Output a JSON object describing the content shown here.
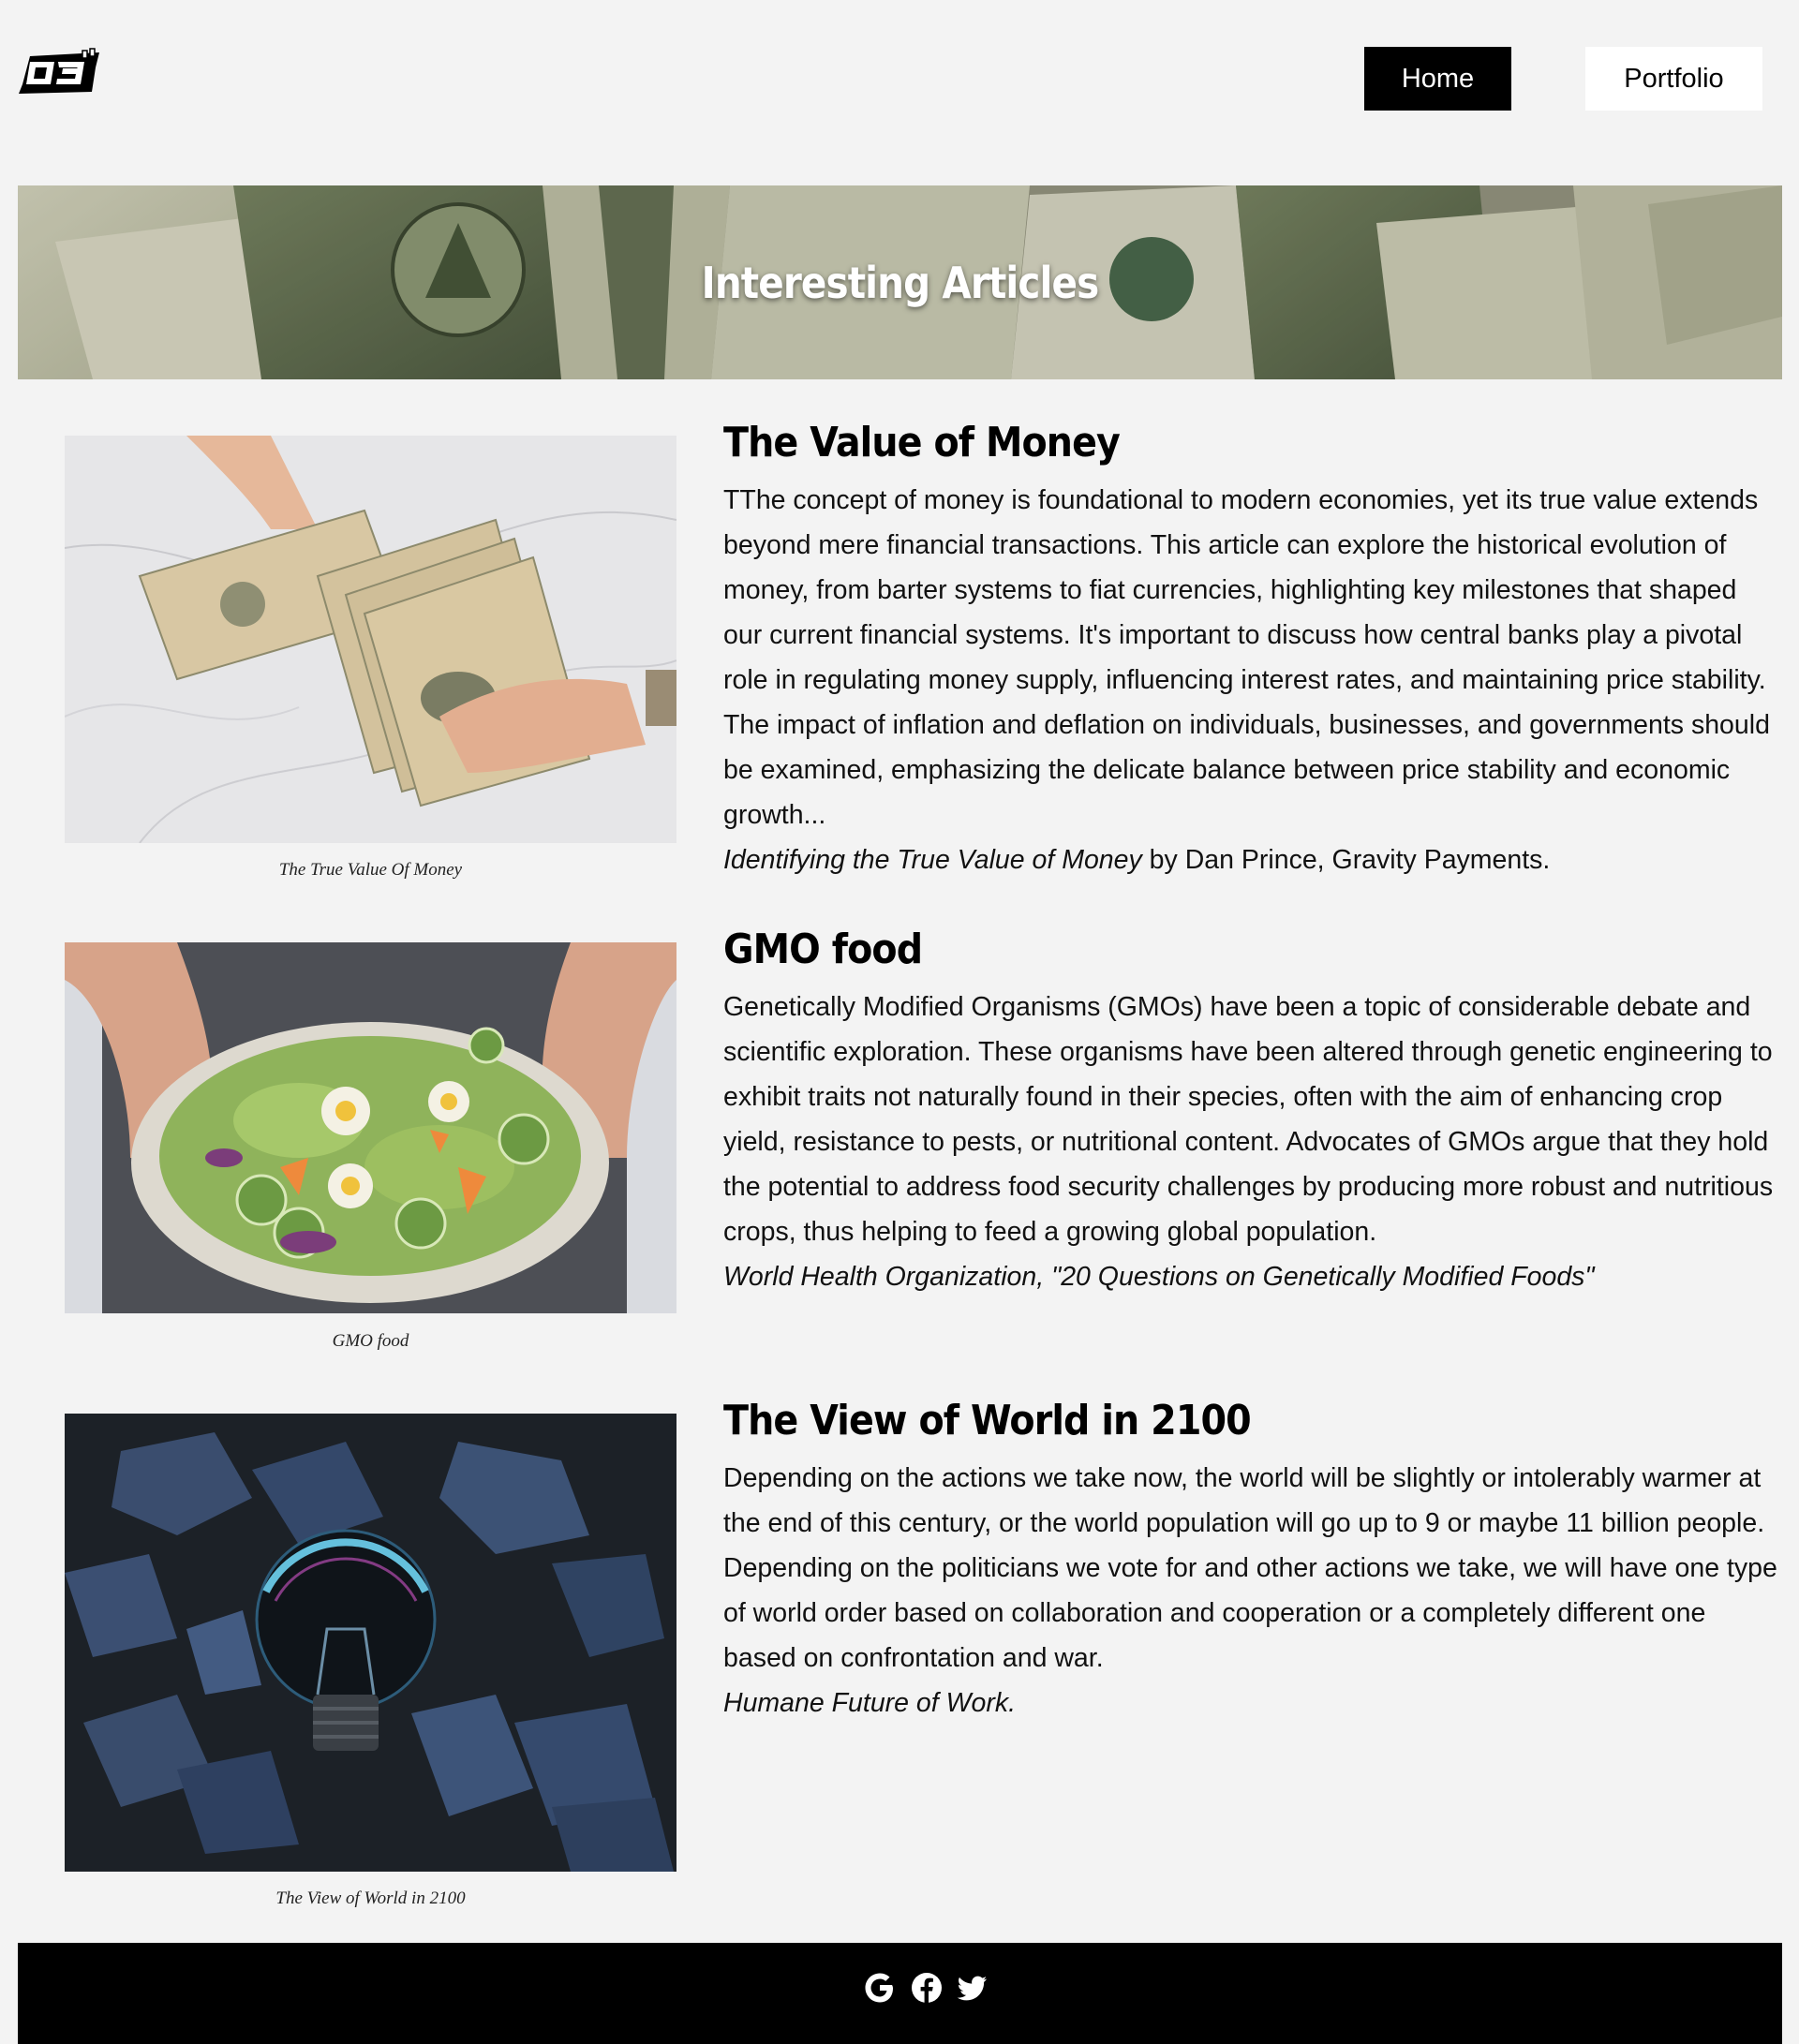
{
  "nav": {
    "home_label": "Home",
    "portfolio_label": "Portfolio"
  },
  "banner": {
    "title": "Interesting Articles"
  },
  "articles": [
    {
      "title": "The Value of Money",
      "body": "TThe concept of money is foundational to modern economies, yet its true value extends beyond mere financial transactions. This article can explore the historical evolution of money, from barter systems to fiat currencies, highlighting key milestones that shaped our current financial systems. It's important to discuss how central banks play a pivotal role in regulating money supply, influencing interest rates, and maintaining price stability. The impact of inflation and deflation on individuals, businesses, and governments should be examined, emphasizing the delicate balance between price stability and economic growth...",
      "source_italic": "Identifying the True Value of Money",
      "source_rest": " by Dan Prince, Gravity Payments.",
      "caption": "The True Value Of Money"
    },
    {
      "title": "GMO food",
      "body": "Genetically Modified Organisms (GMOs) have been a topic of considerable debate and scientific exploration. These organisms have been altered through genetic engineering to exhibit traits not naturally found in their species, often with the aim of enhancing crop yield, resistance to pests, or nutritional content. Advocates of GMOs argue that they hold the potential to address food security challenges by producing more robust and nutritious crops, thus helping to feed a growing global population.",
      "source_italic": "World Health Organization, \"20 Questions on Genetically Modified Foods\"",
      "source_rest": "",
      "caption": "GMO food"
    },
    {
      "title": "The View of World in 2100",
      "body": "Depending on the actions we take now, the world will be slightly or intolerably warmer at the end of this century, or the world population will go up to 9 or maybe 11 billion people. Depending on the politicians we vote for and other actions we take, we will have one type of world order based on collaboration and cooperation or a completely different one based on confrontation and war.",
      "source_italic": "Humane Future of Work.",
      "source_rest": "",
      "caption": "The View of World in 2100"
    }
  ],
  "footer": {
    "icons": [
      "google-icon",
      "facebook-icon",
      "twitter-icon"
    ]
  }
}
